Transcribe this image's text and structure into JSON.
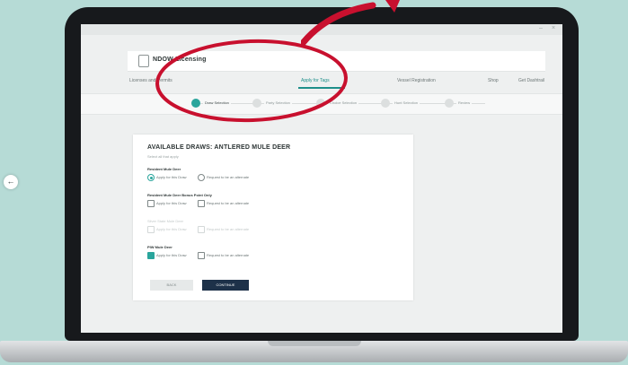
{
  "app": {
    "title": "NDOW Licensing"
  },
  "window": {
    "minimize": "–",
    "close": "×"
  },
  "nav": {
    "tabs": [
      {
        "label": "Licenses and Permits",
        "active": false
      },
      {
        "label": "Apply for Tags",
        "active": true
      },
      {
        "label": "Vessel Registration",
        "active": false
      },
      {
        "label": "Shop",
        "active": false
      },
      {
        "label": "Get Dashtrail",
        "active": false
      }
    ]
  },
  "stepper": {
    "steps": [
      {
        "label": "Draw Selection",
        "active": true
      },
      {
        "label": "Party Selection",
        "active": false
      },
      {
        "label": "Choice Selection",
        "active": false
      },
      {
        "label": "Hunt Selection",
        "active": false
      },
      {
        "label": "Review",
        "active": false
      }
    ]
  },
  "back_nav": {
    "icon": "arrow-left-icon",
    "glyph": "←"
  },
  "card": {
    "title": "AVAILABLE DRAWS: ANTLERED MULE DEER",
    "subtitle": "Select all that apply",
    "sections": [
      {
        "title": "Resident Mule Deer",
        "disabled": false,
        "options": [
          {
            "label": "Apply for this Draw",
            "type": "radio",
            "checked": true
          },
          {
            "label": "Request to be an alternate",
            "type": "checkbox",
            "checked": false
          }
        ]
      },
      {
        "title": "Resident Mule Deer Bonus Point Only",
        "disabled": false,
        "options": [
          {
            "label": "Apply for this Draw",
            "type": "checkbox",
            "checked": false
          },
          {
            "label": "Request to be an alternate",
            "type": "checkbox",
            "checked": false
          }
        ]
      },
      {
        "title": "Silver State Mule Deer",
        "disabled": true,
        "options": [
          {
            "label": "Apply for this Draw",
            "type": "checkbox",
            "checked": false
          },
          {
            "label": "Request to be an alternate",
            "type": "checkbox",
            "checked": false
          }
        ]
      },
      {
        "title": "PIW Mule Deer",
        "disabled": false,
        "options": [
          {
            "label": "Apply for this Draw",
            "type": "checkbox",
            "checked": true
          },
          {
            "label": "Request to be an alternate",
            "type": "checkbox",
            "checked": false
          }
        ]
      }
    ],
    "back_label": "BACK",
    "continue_label": "CONTINUE"
  },
  "colors": {
    "accent": "#2aa59c",
    "annotation": "#c8102e",
    "primary_button": "#1d3149",
    "background": "#b6dbd6"
  }
}
